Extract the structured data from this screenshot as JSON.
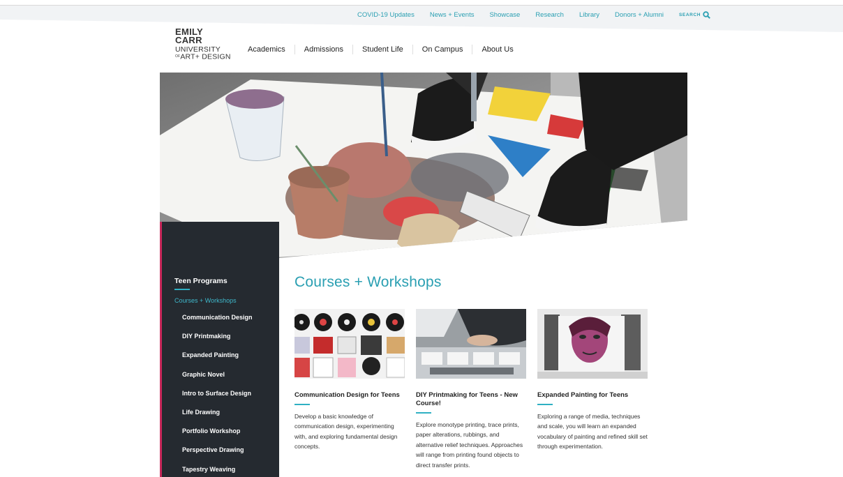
{
  "colors": {
    "accent": "#2a9fb2",
    "sidebar_bg": "#252a30",
    "sidebar_accent": "#c7285a"
  },
  "utility_nav": {
    "links": [
      "COVID-19 Updates",
      "News + Events",
      "Showcase",
      "Research",
      "Library",
      "Donors + Alumni"
    ],
    "search_label": "SEARCH",
    "search_icon": "search-icon"
  },
  "logo": {
    "line1": "EMILY",
    "line2": "CARR",
    "line3": "UNIVERSITY",
    "line4_small": "OF",
    "line4": "ART+ DESIGN"
  },
  "main_nav": [
    "Academics",
    "Admissions",
    "Student Life",
    "On Campus",
    "About Us"
  ],
  "sidebar": {
    "title": "Teen Programs",
    "active": "Courses + Workshops",
    "items": [
      "Communication Design",
      "DIY Printmaking",
      "Expanded Painting",
      "Graphic Novel",
      "Intro to Surface Design",
      "Life Drawing",
      "Portfolio Workshop",
      "Perspective Drawing",
      "Tapestry Weaving"
    ]
  },
  "main": {
    "title": "Courses + Workshops",
    "cards": [
      {
        "title": "Communication Design for Teens",
        "description": "Develop a basic knowledge of communication design, experimenting with, and exploring fundamental design concepts."
      },
      {
        "title": "DIY Printmaking for Teens - New Course!",
        "description": "Explore monotype printing, trace prints, paper alterations, rubbings, and alternative relief techniques. Approaches will range from printing found objects to direct transfer prints."
      },
      {
        "title": "Expanded Painting for Teens",
        "description": "Exploring a range of media, techniques and scale, you will learn an expanded vocabulary of painting and refined skill set through experimentation."
      }
    ]
  }
}
